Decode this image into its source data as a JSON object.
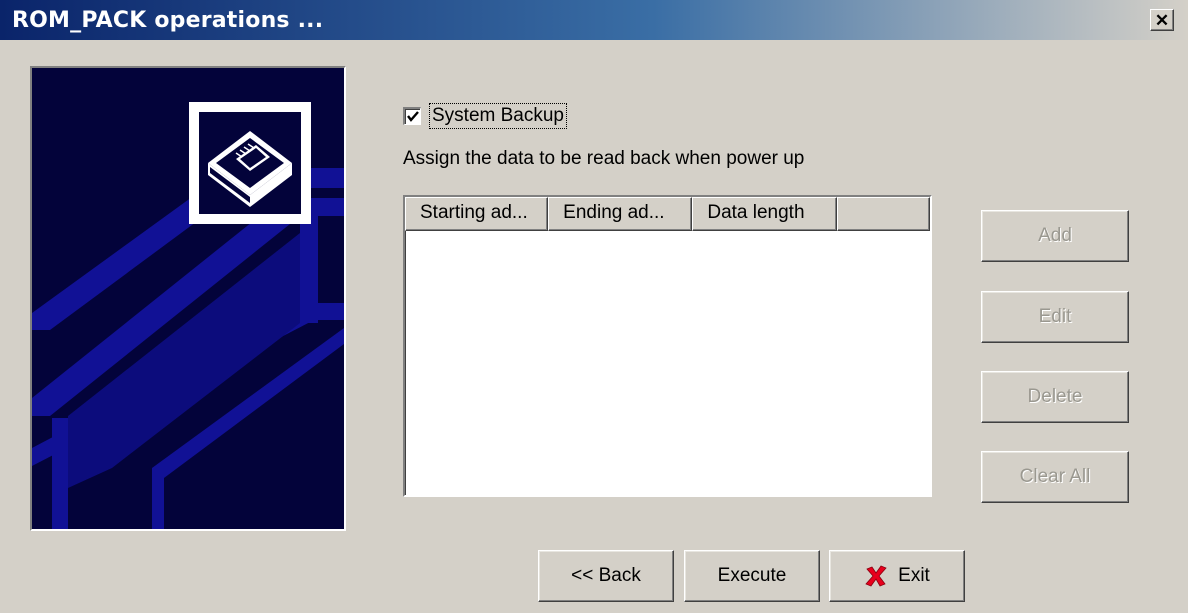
{
  "window": {
    "title": "ROM_PACK operations ...",
    "close_glyph": "✕"
  },
  "options": {
    "system_backup_label": "System Backup",
    "system_backup_checked": true
  },
  "instruction_text": "Assign the data to be read back when power up",
  "table": {
    "columns": [
      "Starting ad...",
      "Ending ad...",
      "Data length",
      ""
    ],
    "rows": []
  },
  "side_buttons": {
    "add": "Add",
    "edit": "Edit",
    "delete": "Delete",
    "clear_all": "Clear All"
  },
  "bottom_buttons": {
    "back": "<< Back",
    "execute": "Execute",
    "exit": "Exit"
  },
  "icons": {
    "wizard_art": "chip-tray-icon",
    "exit": "red-x-icon"
  },
  "colors": {
    "title_start": "#0a246a",
    "title_end": "#d4d0c8",
    "panel_bg": "#03033a",
    "panel_lines": "#1a1aa6",
    "exit_icon": "#e8001c"
  }
}
